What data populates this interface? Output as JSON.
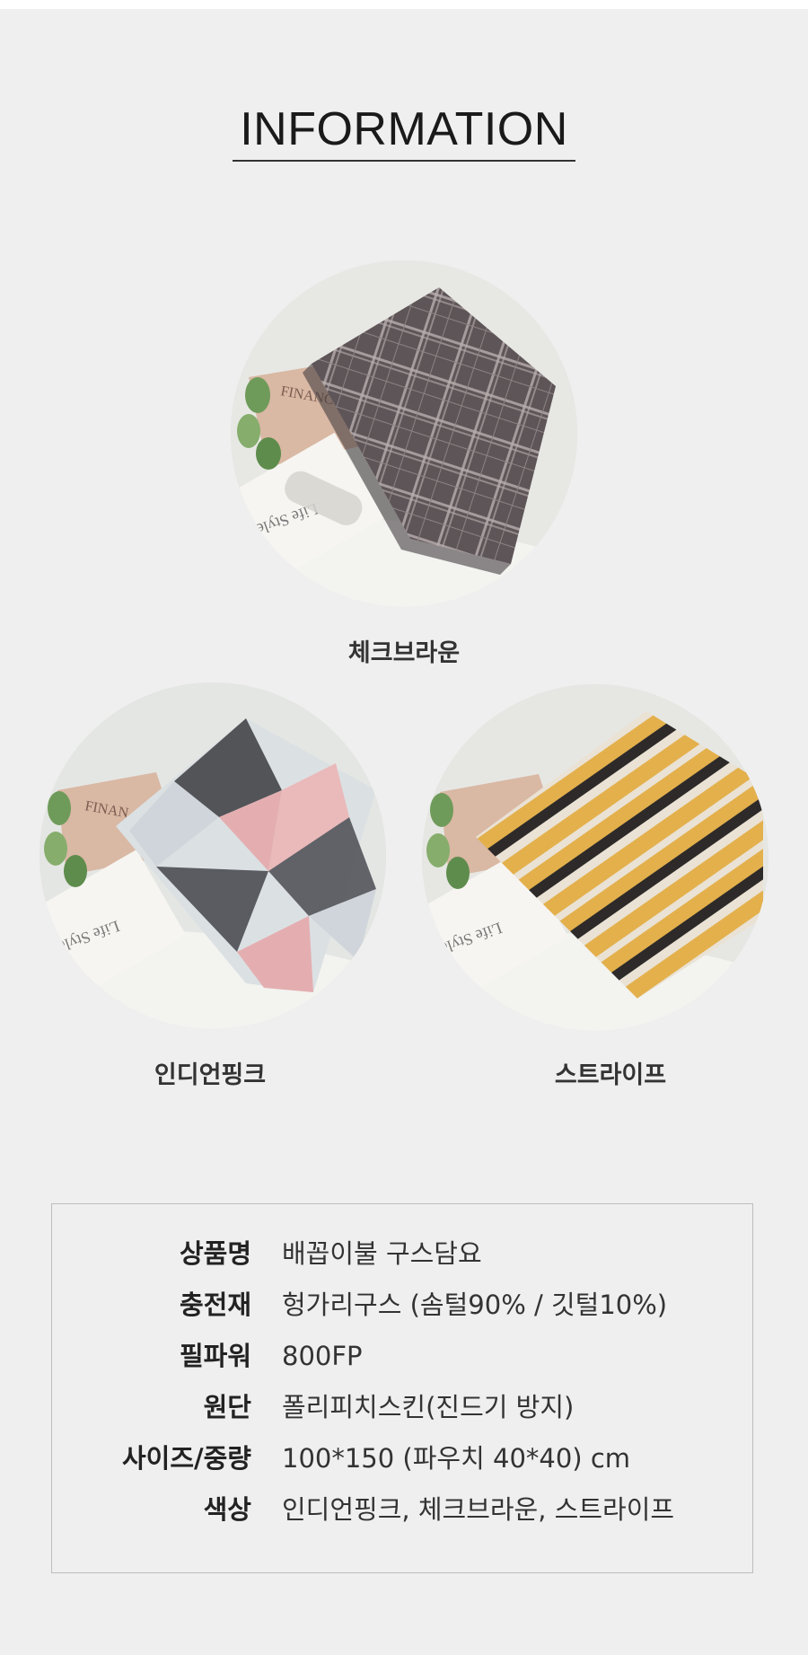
{
  "header": {
    "title": "INFORMATION"
  },
  "products": [
    {
      "name": "체크브라운",
      "pattern": "plaid"
    },
    {
      "name": "인디언핑크",
      "pattern": "geometric-triangles"
    },
    {
      "name": "스트라이프",
      "pattern": "stripes"
    }
  ],
  "photo_text": {
    "magazine": "FINANC",
    "magazine_short": "FINAN",
    "book": "Life Style"
  },
  "info": {
    "rows": [
      {
        "label": "상품명",
        "value": "배꼽이불 구스담요"
      },
      {
        "label": "충전재",
        "value": "헝가리구스 (솜털90% / 깃털10%)"
      },
      {
        "label": "필파워",
        "value": "800FP"
      },
      {
        "label": "원단",
        "value": "폴리피치스킨(진드기 방지)"
      },
      {
        "label": "사이즈/중량",
        "value": "100*150 (파우치 40*40) cm"
      },
      {
        "label": "색상",
        "value": "인디언핑크, 체크브라운, 스트라이프"
      }
    ]
  },
  "colors": {
    "background": "#efefef",
    "plaid": "#5e5558",
    "geometric_pink": "#e4aeb0",
    "stripe_yellow": "#e3b04c",
    "stripe_dark": "#2d2a29"
  }
}
